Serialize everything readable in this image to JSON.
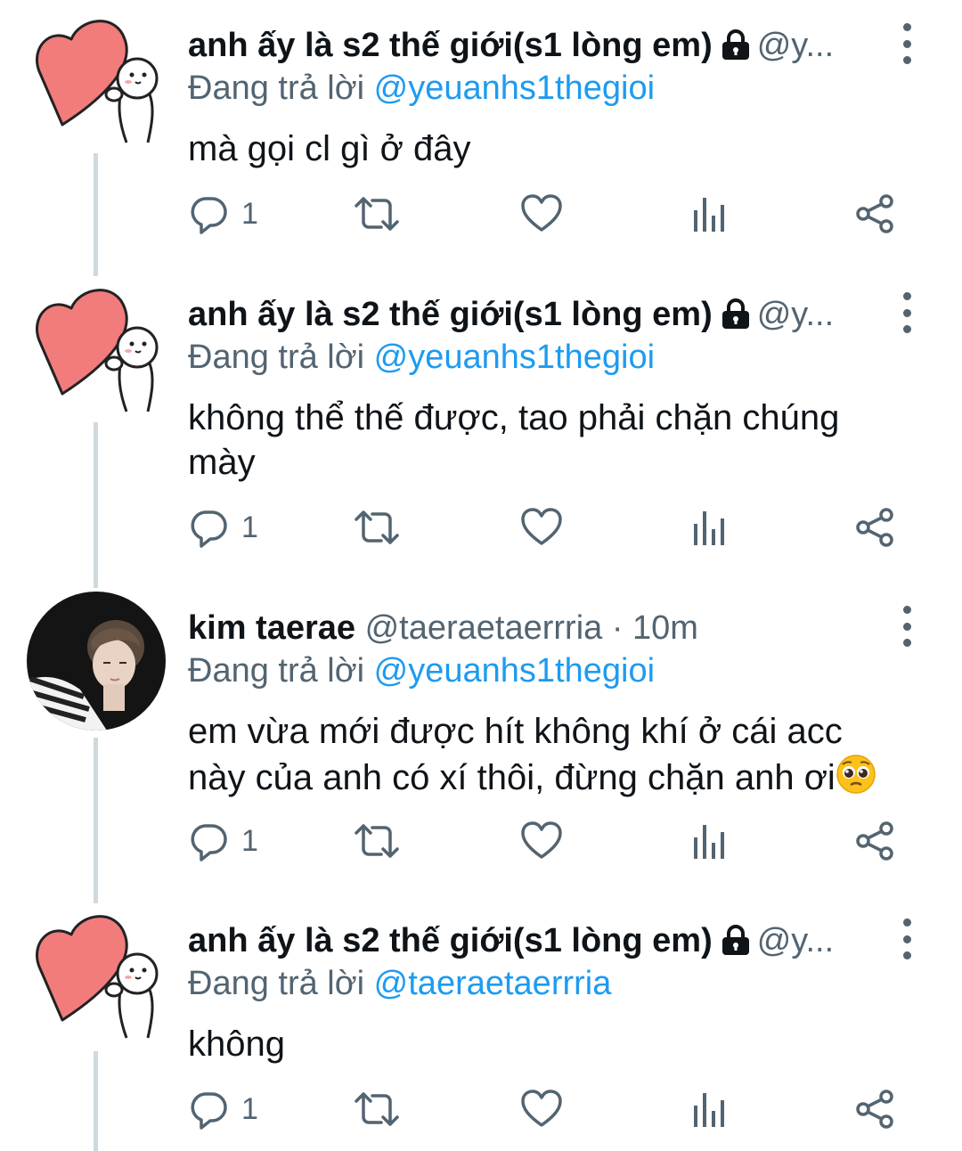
{
  "tweets": [
    {
      "name": "anh ấy là s2 thế giới(s1 lòng em)",
      "handle": "@y...",
      "replying_prefix": "Đang trả lời",
      "replying_to": "@yeuanhs1thegioi",
      "text": "mà gọi cl gì ở đây",
      "reply_count": "1",
      "avatar": "heart-avatar",
      "locked": true
    },
    {
      "name": "anh ấy là s2 thế giới(s1 lòng em)",
      "handle": "@y...",
      "replying_prefix": "Đang trả lời",
      "replying_to": "@yeuanhs1thegioi",
      "text": "không thể thế được, tao phải chặn chúng mày",
      "reply_count": "1",
      "avatar": "heart-avatar",
      "locked": true
    },
    {
      "name": "kim taerae",
      "handle": "@taeraetaerrria · 10m",
      "replying_prefix": "Đang trả lời",
      "replying_to": "@yeuanhs1thegioi",
      "text": "em vừa mới được hít không khí ở cái acc này của anh có xí thôi, đừng chặn anh ơi",
      "text_emoji": "pleading-face-emoji",
      "reply_count": "1",
      "avatar": "photo-avatar",
      "locked": false
    },
    {
      "name": "anh ấy là s2 thế giới(s1 lòng em)",
      "handle": "@y...",
      "replying_prefix": "Đang trả lời",
      "replying_to": "@taeraetaerrria",
      "text": "không",
      "reply_count": "1",
      "avatar": "heart-avatar",
      "locked": true
    }
  ],
  "icons": {
    "reply": "reply-icon",
    "retweet": "retweet-icon",
    "like": "like-icon",
    "views": "views-icon",
    "share": "share-icon",
    "more": "more-options-icon",
    "lock": "lock-icon"
  },
  "colors": {
    "text": "#0f1419",
    "secondary": "#536471",
    "link": "#1d9bf0",
    "thread_line": "#cfd9de",
    "heart": "#f27c7c"
  }
}
